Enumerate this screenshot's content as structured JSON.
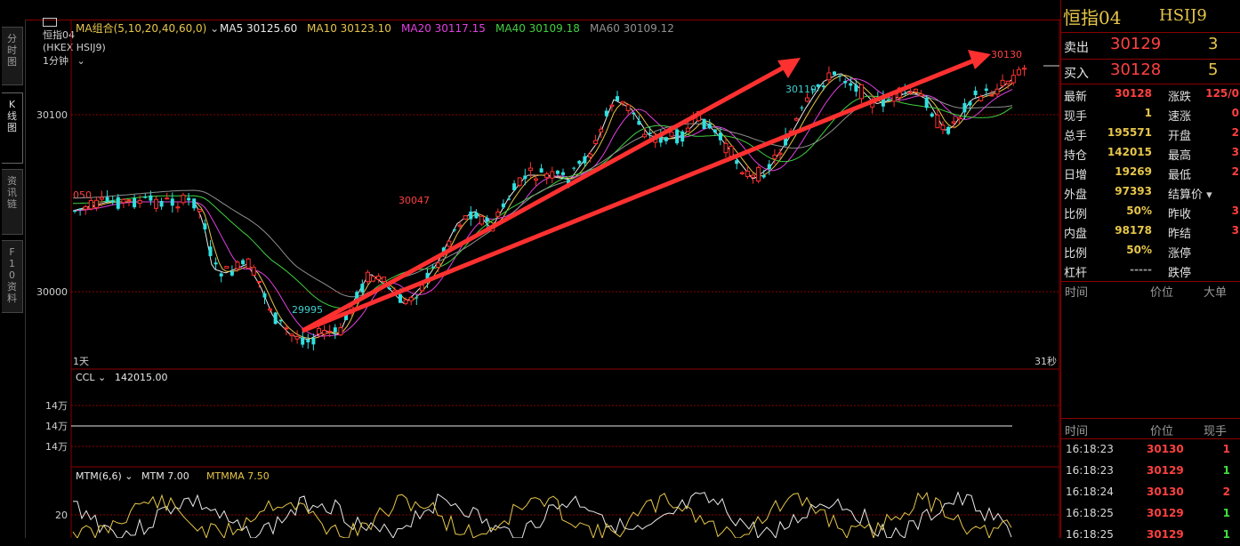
{
  "header": {
    "menu_icon": "window-icon",
    "name": "恒指04",
    "code": "(HKEX HSIJ9)",
    "period": "1分钟"
  },
  "sidebar": {
    "tabs": [
      {
        "label": "分时图",
        "active": false
      },
      {
        "label": "K线图",
        "active": true
      },
      {
        "label": "资讯链",
        "active": false
      },
      {
        "label": "F10资料",
        "active": false
      }
    ]
  },
  "kline": {
    "ma_label": "MA组合(5,10,20,40,60,0)",
    "ma_items": [
      {
        "text": "MA5 30125.60",
        "color": "#e8e8e8"
      },
      {
        "text": "MA10 30123.10",
        "color": "#e6c64a"
      },
      {
        "text": "MA20 30117.15",
        "color": "#e040e0"
      },
      {
        "text": "MA40 30109.18",
        "color": "#40d040"
      },
      {
        "text": "MA60 30109.12",
        "color": "#909090"
      }
    ],
    "y_labels": [
      "30100",
      "30000"
    ],
    "left_edge_label": "050",
    "annotations": [
      "30047",
      "29995",
      "30119",
      "30130"
    ],
    "bottom_left": "1天",
    "bottom_right": "31秒"
  },
  "ccl": {
    "label": "CCL",
    "value": "142015.00",
    "y_labels": [
      "14万",
      "14万",
      "14万"
    ]
  },
  "mtm": {
    "label": "MTM(6,6)",
    "mtm_value": "MTM 7.00",
    "mtmma_value": "MTMMA 7.50",
    "y_label": "20"
  },
  "quote": {
    "title": "恒指04",
    "code": "HSIJ9",
    "sell": {
      "label": "卖出",
      "price": "30129",
      "volume": "3"
    },
    "buy": {
      "label": "买入",
      "price": "30128",
      "volume": "5"
    },
    "rows": [
      {
        "l1": "最新",
        "v1": "30128",
        "v1color": "#ff4040",
        "l2": "涨跌",
        "v2": "125/0"
      },
      {
        "l1": "现手",
        "v1": "1",
        "v1color": "#e6c64a",
        "l2": "速涨",
        "v2": "0"
      },
      {
        "l1": "总手",
        "v1": "195571",
        "v1color": "#e6c64a",
        "l2": "开盘",
        "v2": "2"
      },
      {
        "l1": "持仓",
        "v1": "142015",
        "v1color": "#e6c64a",
        "l2": "最高",
        "v2": "3"
      },
      {
        "l1": "日增",
        "v1": "19269",
        "v1color": "#e6c64a",
        "l2": "最低",
        "v2": "2"
      },
      {
        "l1": "外盘",
        "v1": "97393",
        "v1color": "#e6c64a",
        "l2": "结算价",
        "v2": ""
      },
      {
        "l1": "比例",
        "v1": "50%",
        "v1color": "#e6c64a",
        "l2": "昨收",
        "v2": "3"
      },
      {
        "l1": "内盘",
        "v1": "98178",
        "v1color": "#e6c64a",
        "l2": "昨结",
        "v2": "3"
      },
      {
        "l1": "比例",
        "v1": "50%",
        "v1color": "#e6c64a",
        "l2": "涨停",
        "v2": ""
      },
      {
        "l1": "杠杆",
        "v1": "-----",
        "v1color": "#9a9a9a",
        "l2": "跌停",
        "v2": ""
      }
    ],
    "big_header": {
      "time": "时间",
      "price": "价位",
      "big": "大单"
    },
    "tick_header": {
      "time": "时间",
      "price": "价位",
      "vol": "现手"
    },
    "ticks": [
      {
        "time": "16:18:23",
        "price": "30130",
        "vol": "1",
        "color": "#ff4040"
      },
      {
        "time": "16:18:23",
        "price": "30129",
        "vol": "1",
        "color": "#40e040"
      },
      {
        "time": "16:18:24",
        "price": "30130",
        "vol": "2",
        "color": "#ff4040"
      },
      {
        "time": "16:18:25",
        "price": "30129",
        "vol": "1",
        "color": "#40e040"
      },
      {
        "time": "16:18:25",
        "price": "30129",
        "vol": "1",
        "color": "#40e040"
      }
    ]
  },
  "colors": {
    "up": "#ff3030",
    "down": "#30e0e0",
    "grid": "#8a0000",
    "arrow": "#ff3030"
  }
}
